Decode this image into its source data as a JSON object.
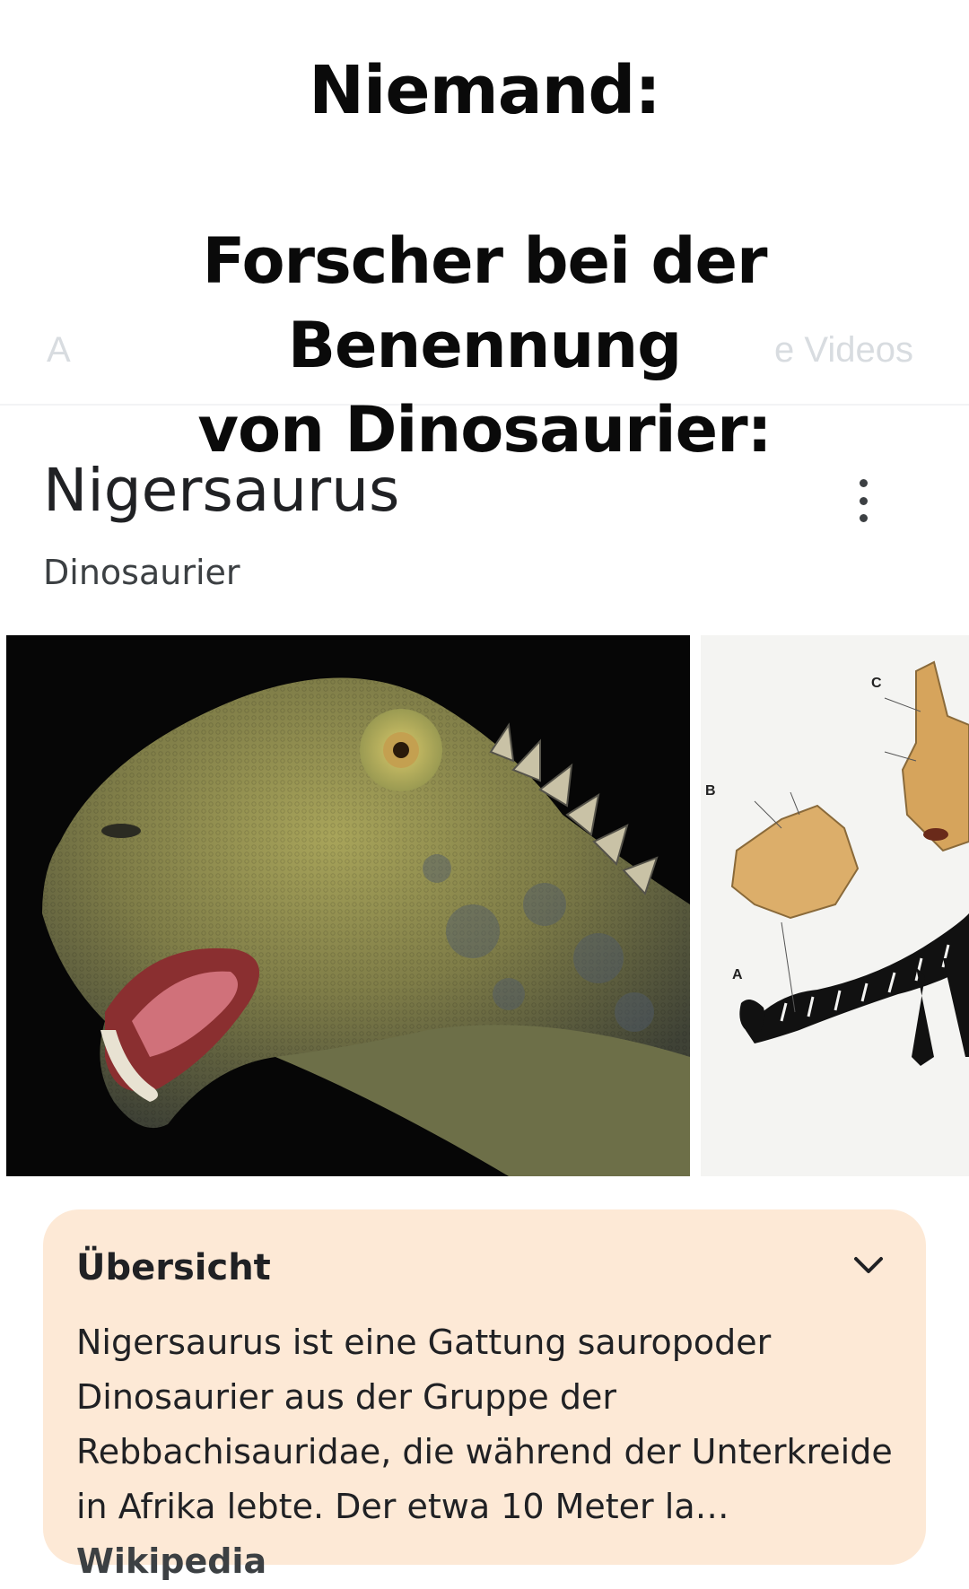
{
  "meme": {
    "line1": "Niemand:",
    "line2a": "Forscher bei der Benennung",
    "line2b": "von Dinosaurier:"
  },
  "background_tabs": {
    "left": "A",
    "right": "e Videos"
  },
  "knowledge_panel": {
    "title": "Nigersaurus",
    "subtitle": "Dinosaurier",
    "menu_icon": "more-vert-icon"
  },
  "images": {
    "main_alt": "Nigersaurus head reconstruction",
    "side_alt": "Nigersaurus skeleton diagram",
    "side_labels": [
      "C",
      "B",
      "A"
    ]
  },
  "overview": {
    "heading": "Übersicht",
    "expand_icon": "chevron-down-icon",
    "text": "Nigersaurus ist eine Gattung sauropoder Dinosaurier aus der Gruppe der Rebbachisauridae, die während der Unterkreide in Afrika lebte. Der etwa 10 Meter la",
    "ellipsis": "…",
    "source": "Wikipedia",
    "background_color": "#fde9d6"
  }
}
